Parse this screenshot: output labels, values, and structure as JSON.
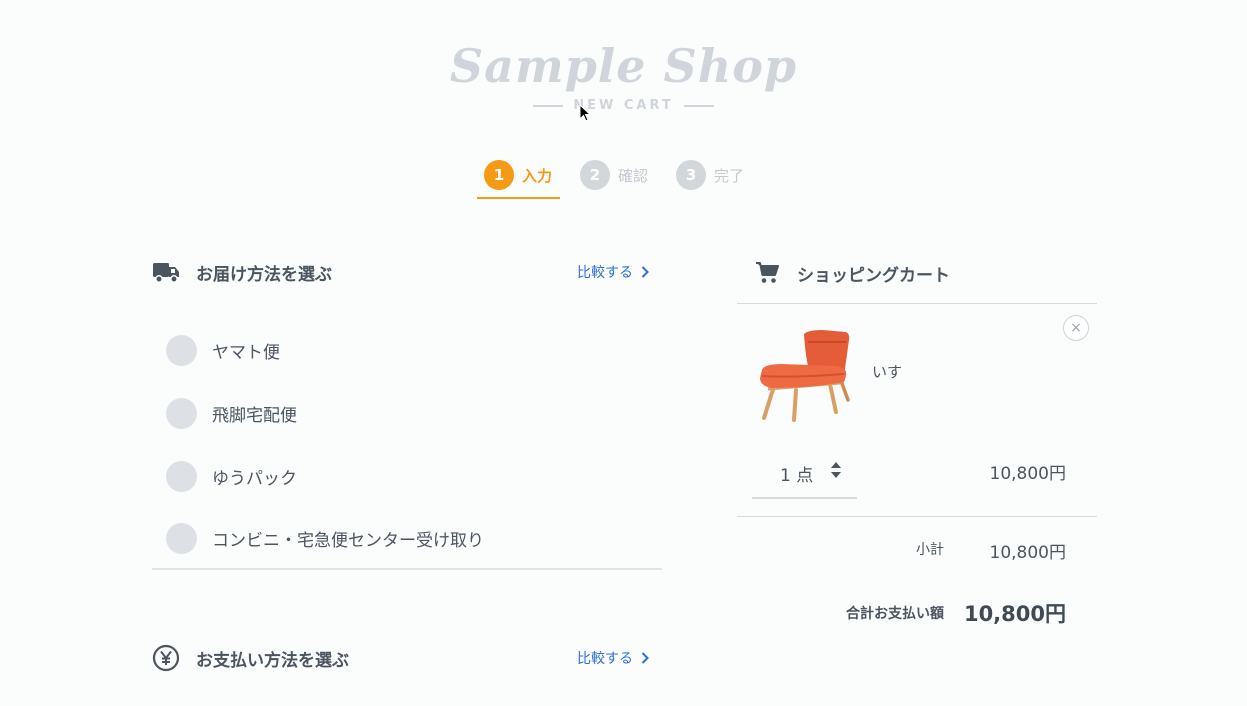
{
  "logo": {
    "script": "Sample Shop",
    "sub": "NEW CART"
  },
  "steps": [
    {
      "num": "1",
      "label": "入力"
    },
    {
      "num": "2",
      "label": "確認"
    },
    {
      "num": "3",
      "label": "完了"
    }
  ],
  "delivery": {
    "title": "お届け方法を選ぶ",
    "compare": "比較する",
    "options": [
      "ヤマト便",
      "飛脚宅配便",
      "ゆうパック",
      "コンビニ・宅急便センター受け取り"
    ]
  },
  "payment": {
    "title": "お支払い方法を選ぶ",
    "compare": "比較する"
  },
  "cart": {
    "title": "ショッピングカート",
    "close": "×",
    "item": {
      "name": "いす",
      "qty": "1 点",
      "price": "10,800円"
    },
    "subtotal_label": "小計",
    "subtotal": "10,800円",
    "total_label": "合計お支払い額",
    "total": "10,800円"
  },
  "colors": {
    "accent": "#f59a14",
    "link": "#2e6fd8",
    "inactive": "#d2d7dc"
  }
}
